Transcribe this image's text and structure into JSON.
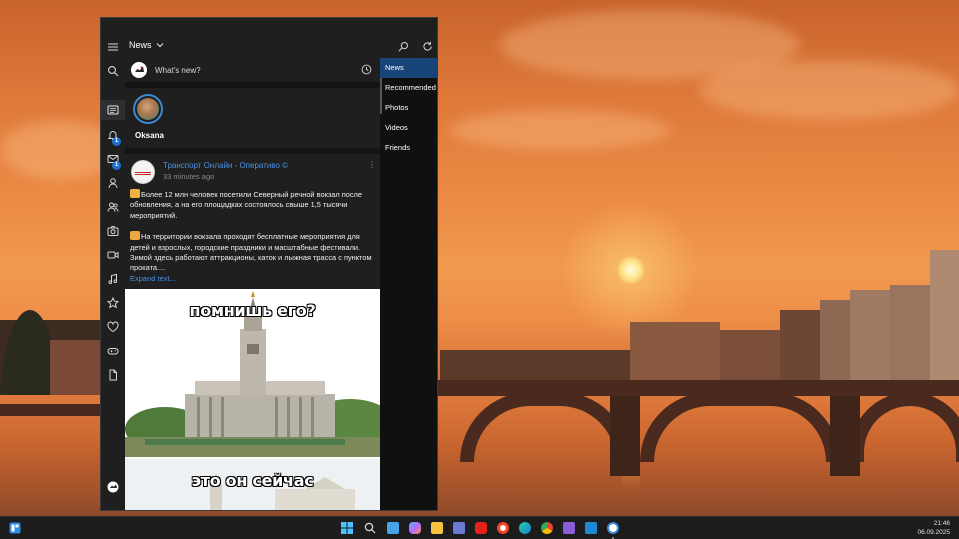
{
  "window": {
    "dropdown_label": "News",
    "whats_new_placeholder": "What's new?",
    "story": {
      "name": "Oksana"
    },
    "post": {
      "source": "Транспорт Онлайн - Оперативо ©",
      "time": "33 minutes ago",
      "paragraph1": "Более 12 млн человек посетили Северный речной вокзал после обновления, а на его площадках состоялось свыше 1,5 тысячи мероприятий.",
      "paragraph2": "На территории вокзала проходят бесплатные мероприятия для детей и взрослых, городские праздники и масштабные фестивали. Зимой здесь работают аттракционы, каток и лыжная трасса с пунктом проката....",
      "expand_label": "Expand text...",
      "meme_top": "помнишь его?",
      "meme_bottom": "это он сейчас"
    },
    "nav": [
      "News",
      "Recommended",
      "Photos",
      "Videos",
      "Friends"
    ],
    "active_nav": "News",
    "badges": {
      "notifications": "1",
      "messages": "1"
    }
  },
  "sidebar_icons": [
    "menu-icon",
    "search-icon",
    "news-feed-icon",
    "bell-icon",
    "mail-icon",
    "profile-icon",
    "friends-icon",
    "camera-icon",
    "video-icon",
    "music-icon",
    "star-icon",
    "heart-icon",
    "gamepad-icon",
    "document-icon",
    "avatar",
    "gear-icon"
  ],
  "taskbar": {
    "time": "21:46",
    "date": "06.09.2025",
    "apps": [
      "widgets-icon",
      "windows-start-icon",
      "search-icon",
      "notepad-icon",
      "copilot-icon",
      "file-explorer-icon",
      "save-icon",
      "youtube-icon",
      "yandex-icon",
      "edge-icon",
      "chrome-icon",
      "visual-studio-icon",
      "vscode-icon",
      "vk-client-icon"
    ]
  },
  "colors": {
    "accent": "#17457a",
    "link": "#4a90e2",
    "badge": "#1f6fd1",
    "window_bg": "#1f1f1f"
  }
}
